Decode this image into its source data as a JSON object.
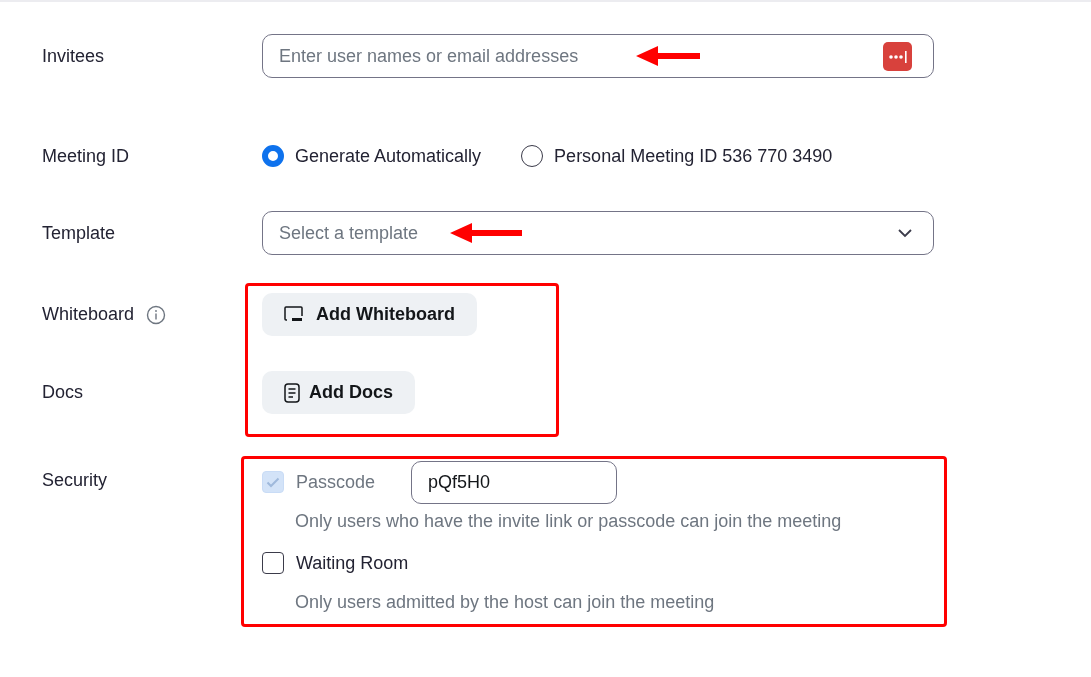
{
  "invitees": {
    "label": "Invitees",
    "placeholder": "Enter user names or email addresses"
  },
  "meeting_id": {
    "label": "Meeting ID",
    "options": [
      {
        "label": "Generate Automatically",
        "selected": true
      },
      {
        "label": "Personal Meeting ID 536 770 3490",
        "selected": false
      }
    ]
  },
  "template": {
    "label": "Template",
    "placeholder": "Select a template"
  },
  "whiteboard": {
    "label": "Whiteboard",
    "button": "Add Whiteboard"
  },
  "docs": {
    "label": "Docs",
    "button": "Add Docs"
  },
  "security": {
    "label": "Security",
    "options": [
      {
        "label": "Passcode",
        "checked": true,
        "disabled": true,
        "value": "pQf5H0",
        "hint": "Only users who have the invite link or passcode can join the meeting"
      },
      {
        "label": "Waiting Room",
        "checked": false,
        "disabled": false,
        "hint": "Only users admitted by the host can join the meeting"
      }
    ]
  }
}
